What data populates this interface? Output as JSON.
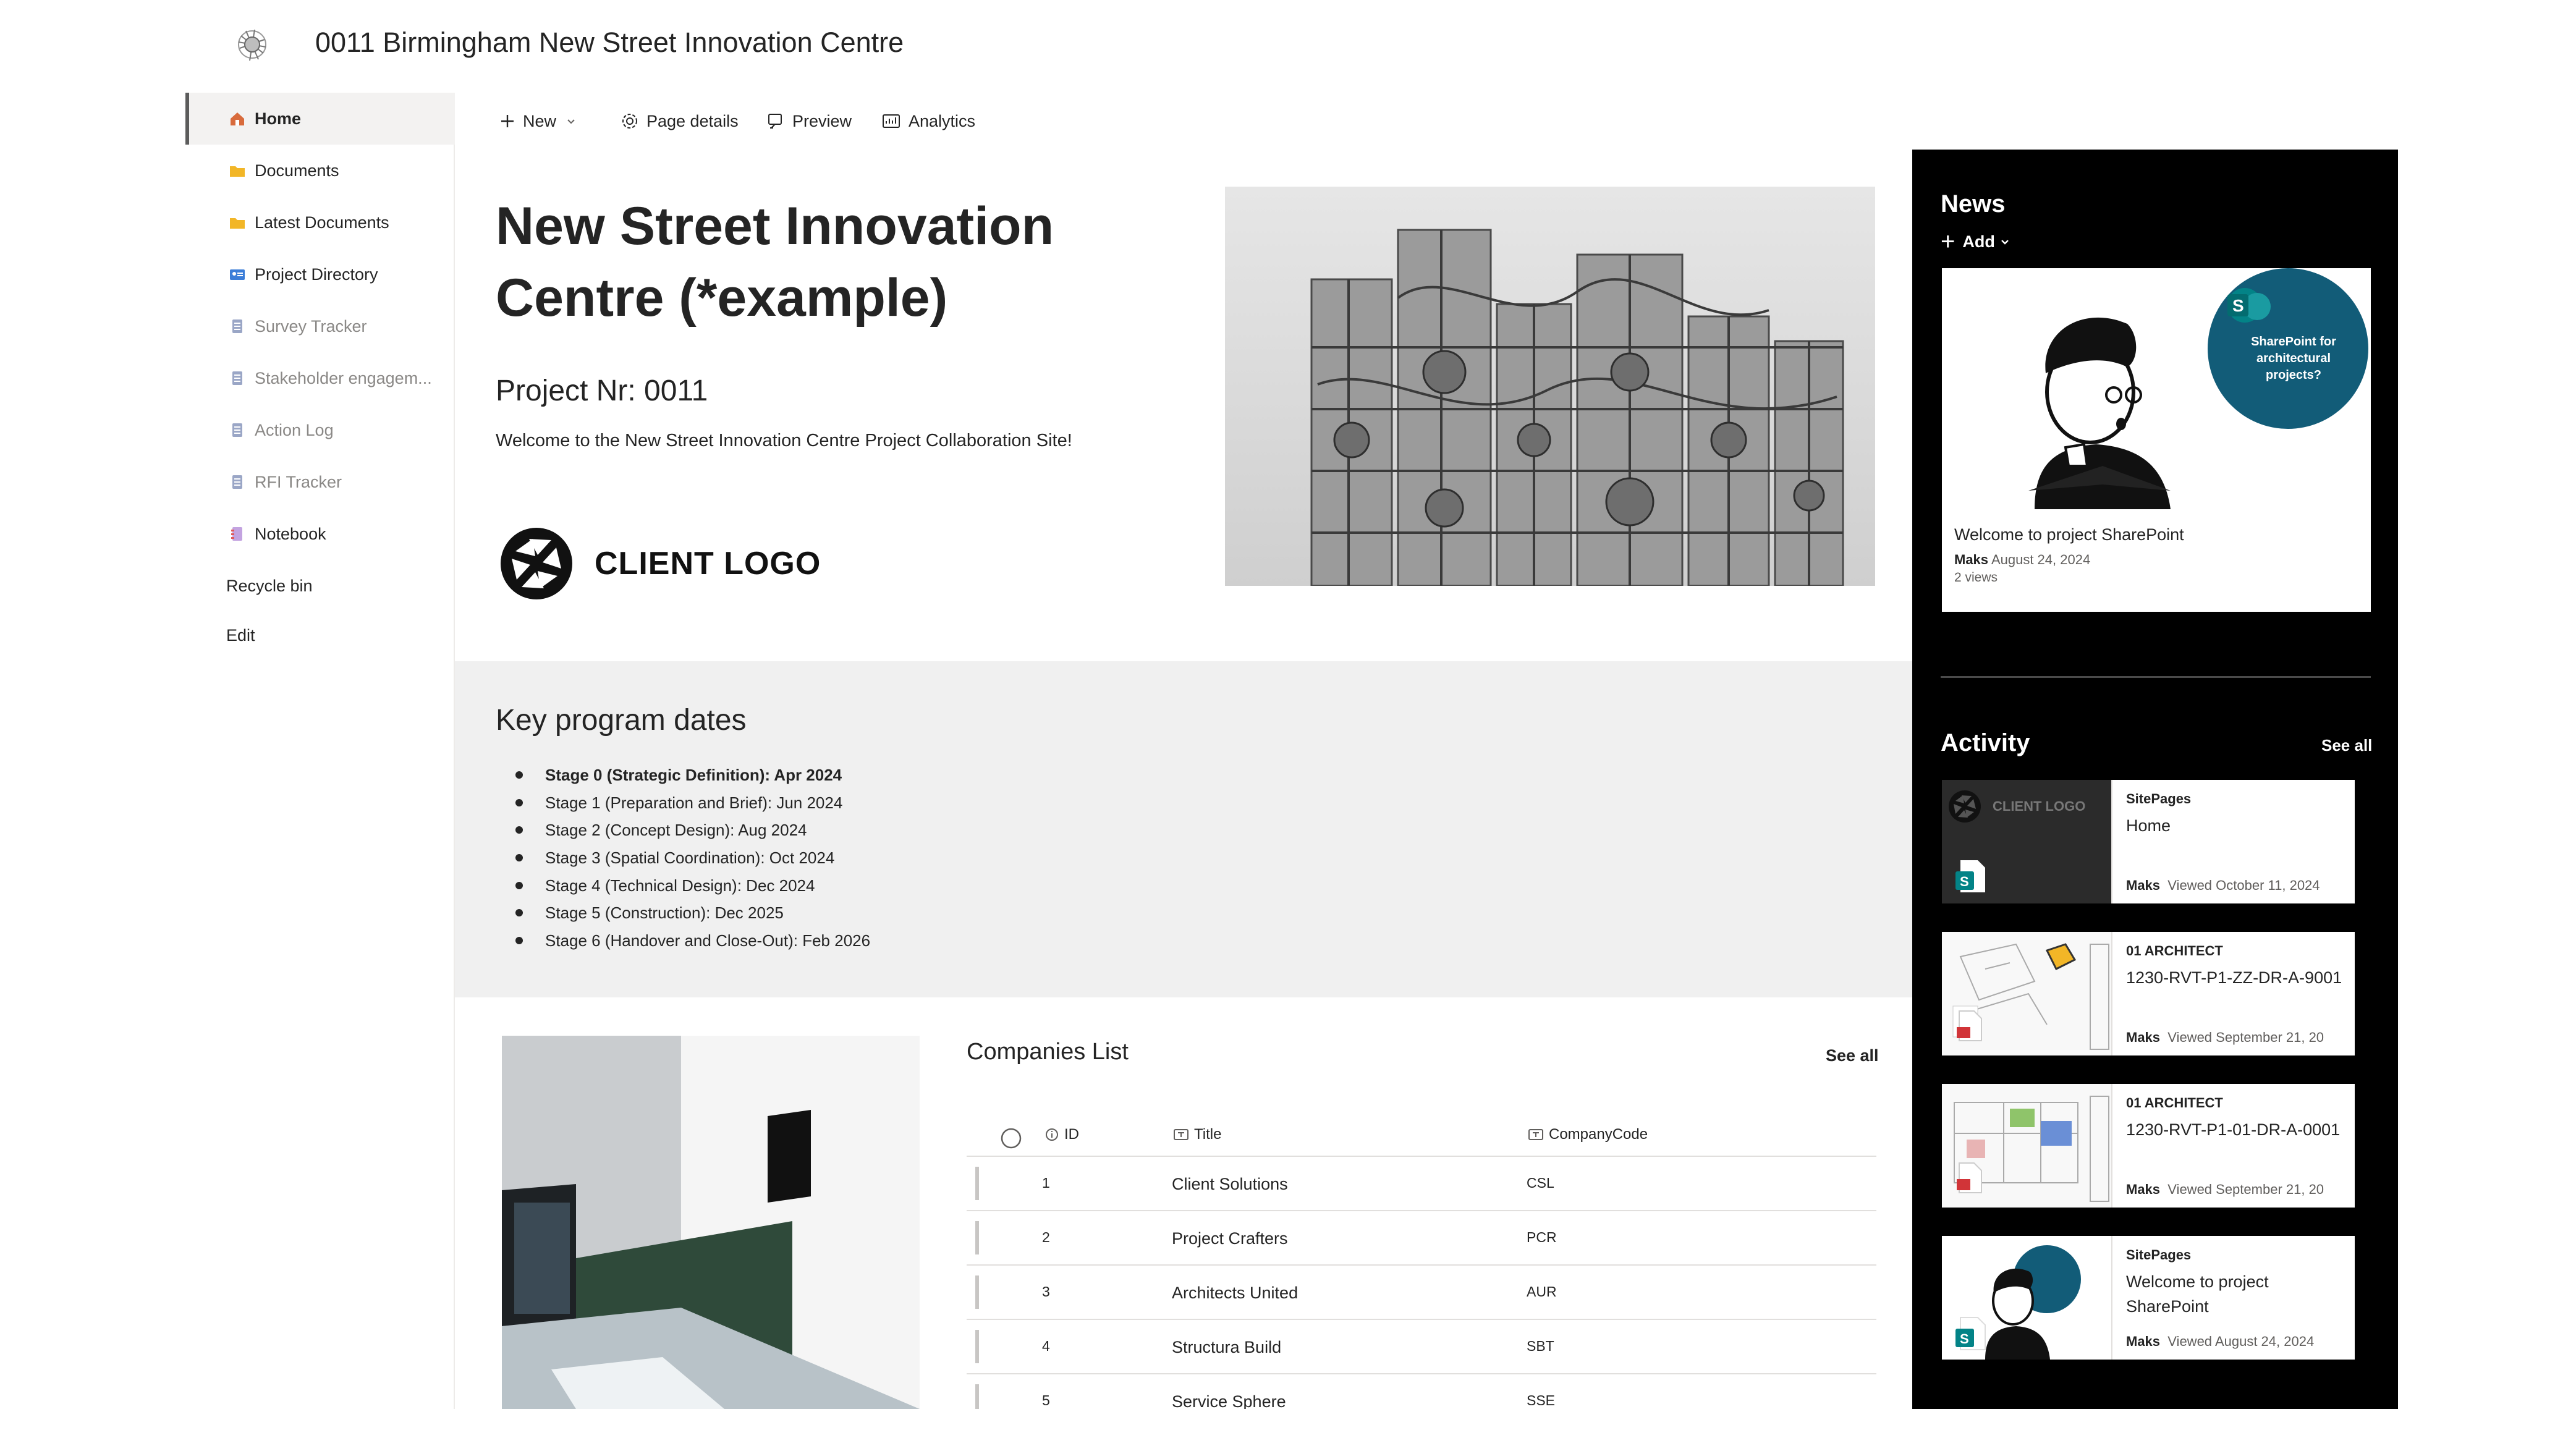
{
  "site": {
    "title": "0011 Birmingham New Street Innovation Centre"
  },
  "nav": {
    "items": [
      {
        "label": "Home"
      },
      {
        "label": "Documents"
      },
      {
        "label": "Latest Documents"
      },
      {
        "label": "Project Directory"
      },
      {
        "label": "Survey Tracker"
      },
      {
        "label": "Stakeholder engagem..."
      },
      {
        "label": "Action Log"
      },
      {
        "label": "RFI Tracker"
      },
      {
        "label": "Notebook"
      },
      {
        "label": "Recycle bin"
      },
      {
        "label": "Edit"
      }
    ]
  },
  "commandbar": {
    "new_label": "New",
    "page_details_label": "Page details",
    "preview_label": "Preview",
    "analytics_label": "Analytics"
  },
  "hero": {
    "title": "New Street Innovation Centre (*example)",
    "project_nr": "Project Nr: 0011",
    "welcome": "Welcome to the New Street Innovation Centre Project Collaboration Site!",
    "client_logo_text": "CLIENT LOGO"
  },
  "key_dates": {
    "heading": "Key program dates",
    "items": [
      "Stage 0 (Strategic Definition): Apr 2024",
      "Stage 1 (Preparation and Brief): Jun 2024",
      "Stage 2 (Concept Design): Aug 2024",
      "Stage 3 (Spatial Coordination): Oct 2024",
      "Stage 4 (Technical Design): Dec 2024",
      "Stage 5 (Construction): Dec 2025",
      "Stage 6 (Handover and Close-Out): Feb 2026"
    ]
  },
  "companies": {
    "title": "Companies List",
    "see_all": "See all",
    "columns": {
      "id": "ID",
      "title": "Title",
      "code": "CompanyCode"
    },
    "rows": [
      {
        "id": "1",
        "title": "Client Solutions",
        "code": "CSL"
      },
      {
        "id": "2",
        "title": "Project Crafters",
        "code": "PCR"
      },
      {
        "id": "3",
        "title": "Architects United",
        "code": "AUR"
      },
      {
        "id": "4",
        "title": "Structura Build",
        "code": "SBT"
      },
      {
        "id": "5",
        "title": "Service Sphere",
        "code": "SSE"
      }
    ]
  },
  "news": {
    "heading": "News",
    "add_label": "Add",
    "card": {
      "bubble_text": "SharePoint for architectural projects?",
      "title": "Welcome to project SharePoint",
      "author": "Maks",
      "date": "August 24, 2024",
      "views": "2 views"
    }
  },
  "activity": {
    "heading": "Activity",
    "see_all": "See all",
    "items": [
      {
        "site": "SitePages",
        "title": "Home",
        "user": "Maks",
        "action": "Viewed October 11, 2024",
        "thumb_text": "CLIENT LOGO"
      },
      {
        "site": "01 ARCHITECT",
        "title": "1230-RVT-P1-ZZ-DR-A-9001",
        "user": "Maks",
        "action": "Viewed September 21, 20"
      },
      {
        "site": "01 ARCHITECT",
        "title": "1230-RVT-P1-01-DR-A-0001",
        "user": "Maks",
        "action": "Viewed September 21, 20"
      },
      {
        "site": "SitePages",
        "title": "Welcome to project SharePoint",
        "user": "Maks",
        "action": "Viewed August 24, 2024"
      }
    ]
  },
  "colors": {
    "accent": "#038387",
    "panel_bg": "#000000",
    "band_bg": "#f0f0f0"
  }
}
